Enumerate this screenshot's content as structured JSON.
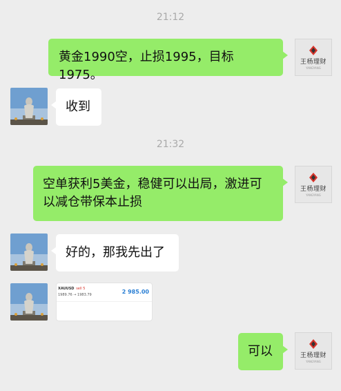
{
  "messages": {
    "ts1": "21:12",
    "m1": "黄金1990空，止损1995，目标1975。",
    "m2": "收到",
    "ts2": "21:32",
    "m3": "空单获利5美金，稳健可以出局，激进可以减仓带保本止损",
    "m4": "好的，那我先出了",
    "m5": "可以"
  },
  "brand": {
    "name": "王杨理财",
    "sub": "YANGYANG"
  },
  "trade_card": {
    "symbol": "XAUUSD",
    "side": "sell 5",
    "prices": "1989.76 → 1983.79",
    "profit": "2 985.00"
  },
  "colors": {
    "background": "#ededed",
    "outgoing_bubble": "#95ec69",
    "incoming_bubble": "#ffffff",
    "timestamp": "#a9a9a9",
    "sell_red": "#d9342b",
    "profit_blue": "#2a7fd4"
  }
}
